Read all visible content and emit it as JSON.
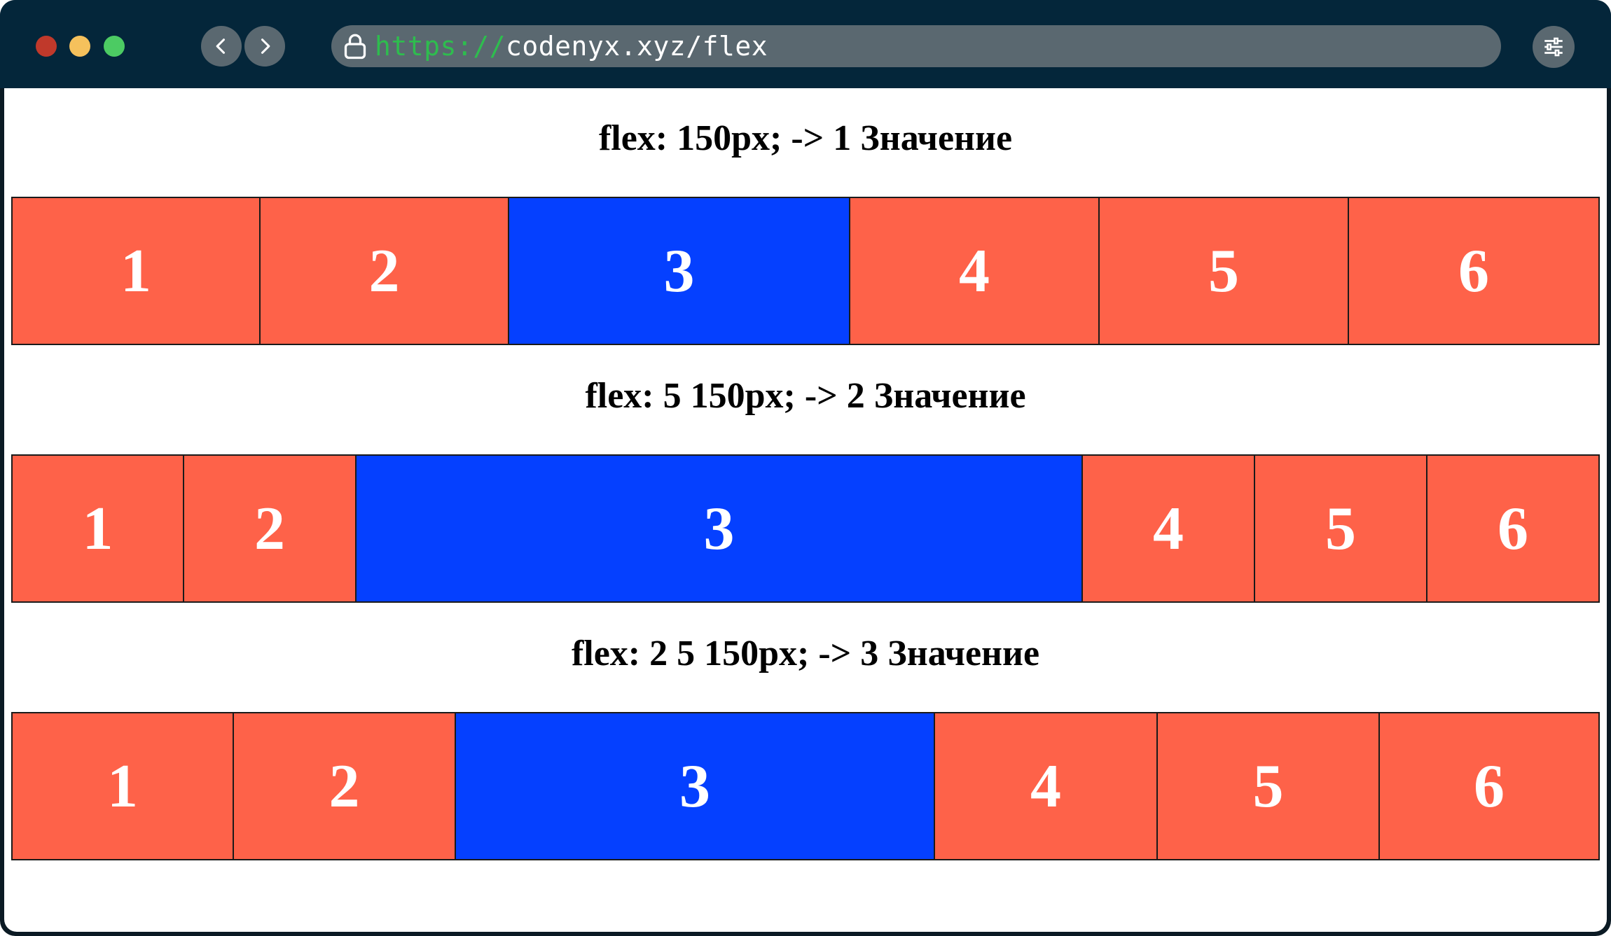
{
  "window": {
    "controls": [
      "close",
      "minimize",
      "maximize"
    ],
    "colors": {
      "titlebar": "#04263a",
      "close": "#c0392b",
      "minimize": "#f5c15c",
      "maximize": "#4ccb63"
    }
  },
  "toolbar": {
    "back_icon": "chevron-left-icon",
    "forward_icon": "chevron-right-icon",
    "menu_icon": "sliders-icon"
  },
  "address_bar": {
    "lock_icon": "lock-icon",
    "protocol": "https://",
    "host": "codenyx.xyz/flex"
  },
  "colors": {
    "box": "#fe6249",
    "accent_box": "#0540ff",
    "box_text": "#ffffff"
  },
  "sections": [
    {
      "heading": "flex: 150px; -> 1 Значение",
      "boxes": [
        "1",
        "2",
        "3",
        "4",
        "5",
        "6"
      ],
      "accent_index": 2
    },
    {
      "heading": "flex: 5 150px; -> 2 Значение",
      "boxes": [
        "1",
        "2",
        "3",
        "4",
        "5",
        "6"
      ],
      "accent_index": 2
    },
    {
      "heading": "flex: 2 5 150px; -> 3 Значение",
      "boxes": [
        "1",
        "2",
        "3",
        "4",
        "5",
        "6"
      ],
      "accent_index": 2
    }
  ]
}
